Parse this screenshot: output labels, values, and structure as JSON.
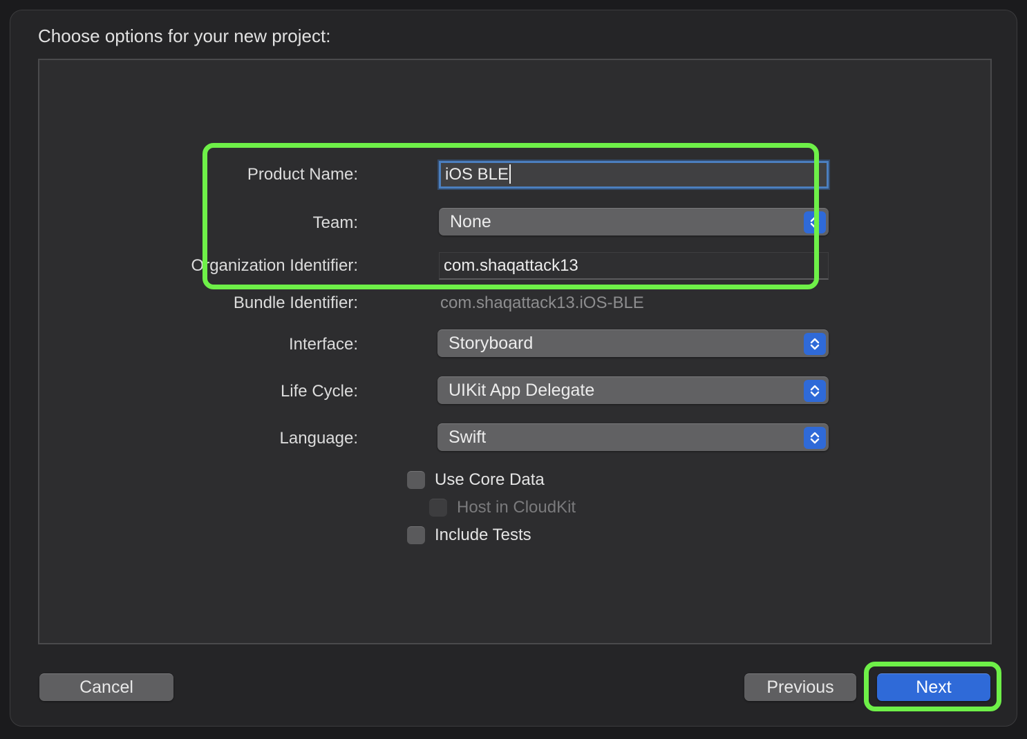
{
  "dialog": {
    "title": "Choose options for your new project:"
  },
  "form": {
    "product_name": {
      "label": "Product Name:",
      "value": "iOS BLE"
    },
    "team": {
      "label": "Team:",
      "value": "None"
    },
    "organization_identifier": {
      "label": "Organization Identifier:",
      "value": "com.shaqattack13"
    },
    "bundle_identifier": {
      "label": "Bundle Identifier:",
      "value": "com.shaqattack13.iOS-BLE"
    },
    "interface": {
      "label": "Interface:",
      "value": "Storyboard"
    },
    "life_cycle": {
      "label": "Life Cycle:",
      "value": "UIKit App Delegate"
    },
    "language": {
      "label": "Language:",
      "value": "Swift"
    },
    "checkboxes": {
      "use_core_data": {
        "label": "Use Core Data",
        "checked": false,
        "enabled": true
      },
      "host_in_cloudkit": {
        "label": "Host in CloudKit",
        "checked": false,
        "enabled": false
      },
      "include_tests": {
        "label": "Include Tests",
        "checked": false,
        "enabled": true
      }
    }
  },
  "buttons": {
    "cancel": "Cancel",
    "previous": "Previous",
    "next": "Next"
  },
  "icons": {
    "popup_stepper": "chevron-up-down-icon"
  },
  "colors": {
    "accent": "#2f6ad8",
    "highlight": "#6ef048",
    "focus_ring": "#4b7fbf"
  }
}
